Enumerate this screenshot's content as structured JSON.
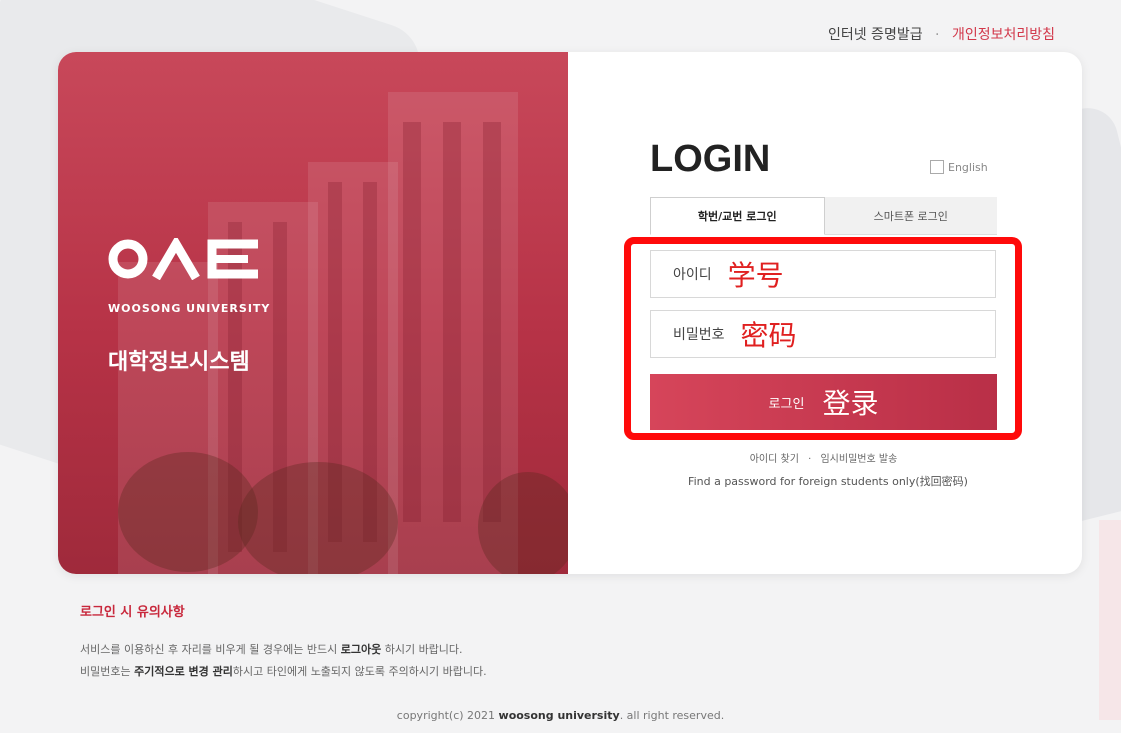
{
  "top_links": {
    "certificate": "인터넷 증명발급",
    "separator": "·",
    "privacy": "개인정보처리방침"
  },
  "hero": {
    "university": "WOOSONG UNIVERSITY",
    "system_name": "대학정보시스템"
  },
  "login": {
    "title": "LOGIN",
    "english_label": "English",
    "tabs": [
      "학번/교번 로그인",
      "스마트폰 로그인"
    ],
    "id_placeholder": "아이디",
    "id_annotation": "学号",
    "pw_placeholder": "비밀번호",
    "pw_annotation": "密码",
    "button_label": "로그인",
    "button_annotation": "登录",
    "find_id": "아이디 찾기",
    "find_separator": "·",
    "temp_password": "임시비밀번호 발송",
    "foreign_link": "Find a password for foreign students only(找回密码)"
  },
  "notice": {
    "title": "로그인 시 유의사항",
    "line1_pre": "서비스를 이용하신 후 자리를 비우게 될 경우에는 반드시 ",
    "line1_bold": "로그아웃",
    "line1_post": " 하시기 바랍니다.",
    "line2_pre": "비밀번호는 ",
    "line2_bold": "주기적으로 변경 관리",
    "line2_post": "하시고 타인에게 노출되지 않도록 주의하시기 바랍니다."
  },
  "footer": {
    "pre": "copyright(c) 2021 ",
    "bold": "woosong university",
    "post": ". all right reserved."
  },
  "colors": {
    "brand_red": "#c8283c",
    "annotation_red": "#ff0a0a"
  }
}
